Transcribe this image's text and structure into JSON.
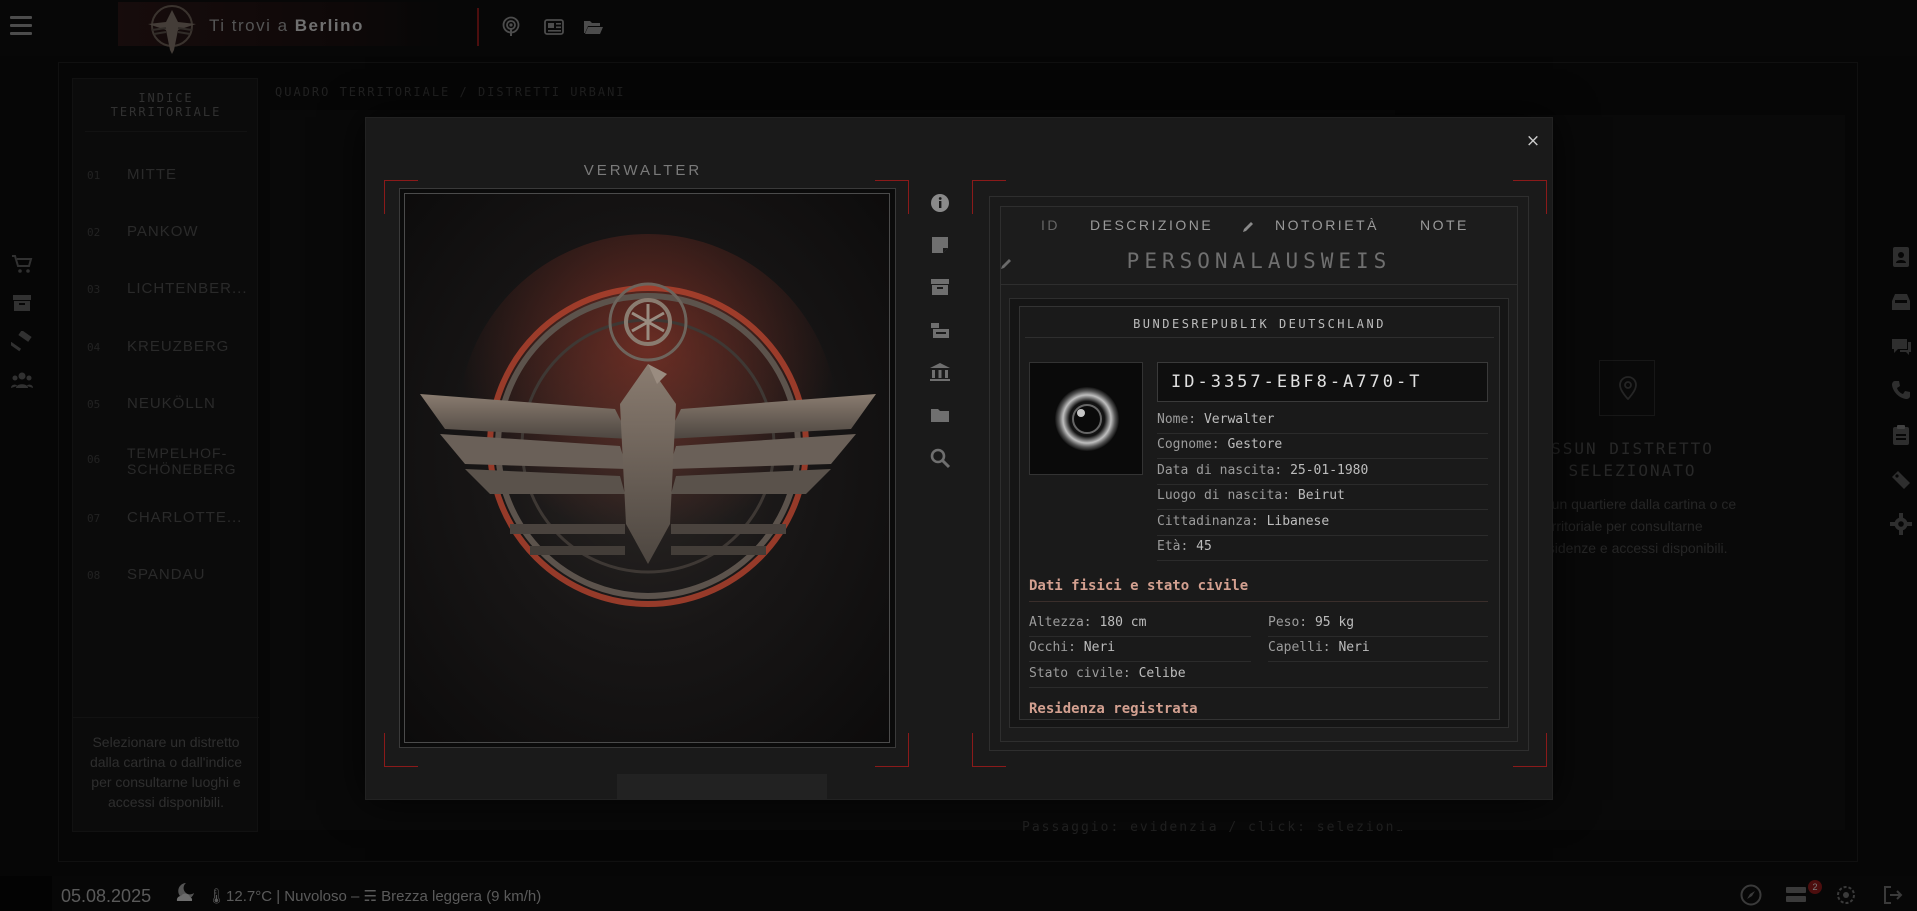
{
  "header": {
    "location_prefix": "Ti trovi a",
    "location_city": "Berlino"
  },
  "sidebar": {
    "title_line1": "INDICE",
    "title_line2": "TERRITORIALE",
    "districts": [
      {
        "num": "01",
        "name": "MITTE"
      },
      {
        "num": "02",
        "name": "PANKOW"
      },
      {
        "num": "03",
        "name": "LICHTENBER..."
      },
      {
        "num": "04",
        "name": "KREUZBERG"
      },
      {
        "num": "05",
        "name": "NEUKÖLLN"
      },
      {
        "num": "06",
        "name": "TEMPELHOF-SCHÖNEBERG"
      },
      {
        "num": "07",
        "name": "CHARLOTTE..."
      },
      {
        "num": "08",
        "name": "SPANDAU"
      }
    ],
    "footer_text": "Selezionare un distretto dalla cartina o dall'indice per consultarne luoghi e accessi disponibili."
  },
  "main": {
    "breadcrumb": "QUADRO TERRITORIALE / DISTRETTI URBANI",
    "hint": "Passaggio: evidenzia / click: seleziona"
  },
  "right_panel": {
    "title": "SSUN DISTRETTO SELEZIONATO",
    "description": "a un quartiere dalla cartina o ce territoriale per consultarne esidenze e accessi disponibili."
  },
  "bottombar": {
    "date": "05.08.2025",
    "weather": "12.7°C | Nuvoloso – ☴ Brezza leggera (9 km/h)",
    "badge_count": "2"
  },
  "modal": {
    "close_label": "×",
    "portrait_name": "VERWALTER",
    "tabs": [
      "ID",
      "DESCRIZIONE",
      "NOTORIETÀ",
      "NOTE"
    ],
    "heading": "PERSONALAUSWEIS",
    "card": {
      "republic": "BUNDESREPUBLIK DEUTSCHLAND",
      "id_number": "ID-3357-EBF8-A770-T",
      "fields": [
        {
          "label": "Nome:",
          "value": "Verwalter"
        },
        {
          "label": "Cognome:",
          "value": "Gestore"
        },
        {
          "label": "Data di nascita:",
          "value": "25-01-1980"
        },
        {
          "label": "Luogo di nascita:",
          "value": "Beirut"
        },
        {
          "label": "Cittadinanza:",
          "value": "Libanese"
        },
        {
          "label": "Età:",
          "value": "45"
        }
      ],
      "physical_title": "Dati fisici e stato civile",
      "physical": {
        "height_label": "Altezza:",
        "height": "180 cm",
        "weight_label": "Peso:",
        "weight": "95 kg",
        "eyes_label": "Occhi:",
        "eyes": "Neri",
        "hair_label": "Capelli:",
        "hair": "Neri",
        "civil_label": "Stato civile:",
        "civil": "Celibe"
      },
      "residence_title": "Residenza registrata"
    }
  },
  "colors": {
    "accent": "#8b1a1a",
    "section_title": "#d3a090"
  },
  "icons": {
    "top": [
      "podcast-icon",
      "newspaper-icon",
      "folder-open-icon"
    ],
    "modal_side": [
      "info-icon",
      "sticky-note-icon",
      "archive-icon",
      "cash-register-icon",
      "bank-icon",
      "folder-icon",
      "search-icon"
    ],
    "left_rail": [
      "cart-icon",
      "archive-icon",
      "hammer-icon",
      "users-icon"
    ],
    "right_rail": [
      "address-book-icon",
      "inbox-icon",
      "chat-icon",
      "phone-icon",
      "clipboard-icon",
      "ticket-icon",
      "gear-icon"
    ],
    "bottom_right": [
      "compass-icon",
      "server-icon",
      "settings-cog-icon",
      "exit-icon"
    ]
  }
}
